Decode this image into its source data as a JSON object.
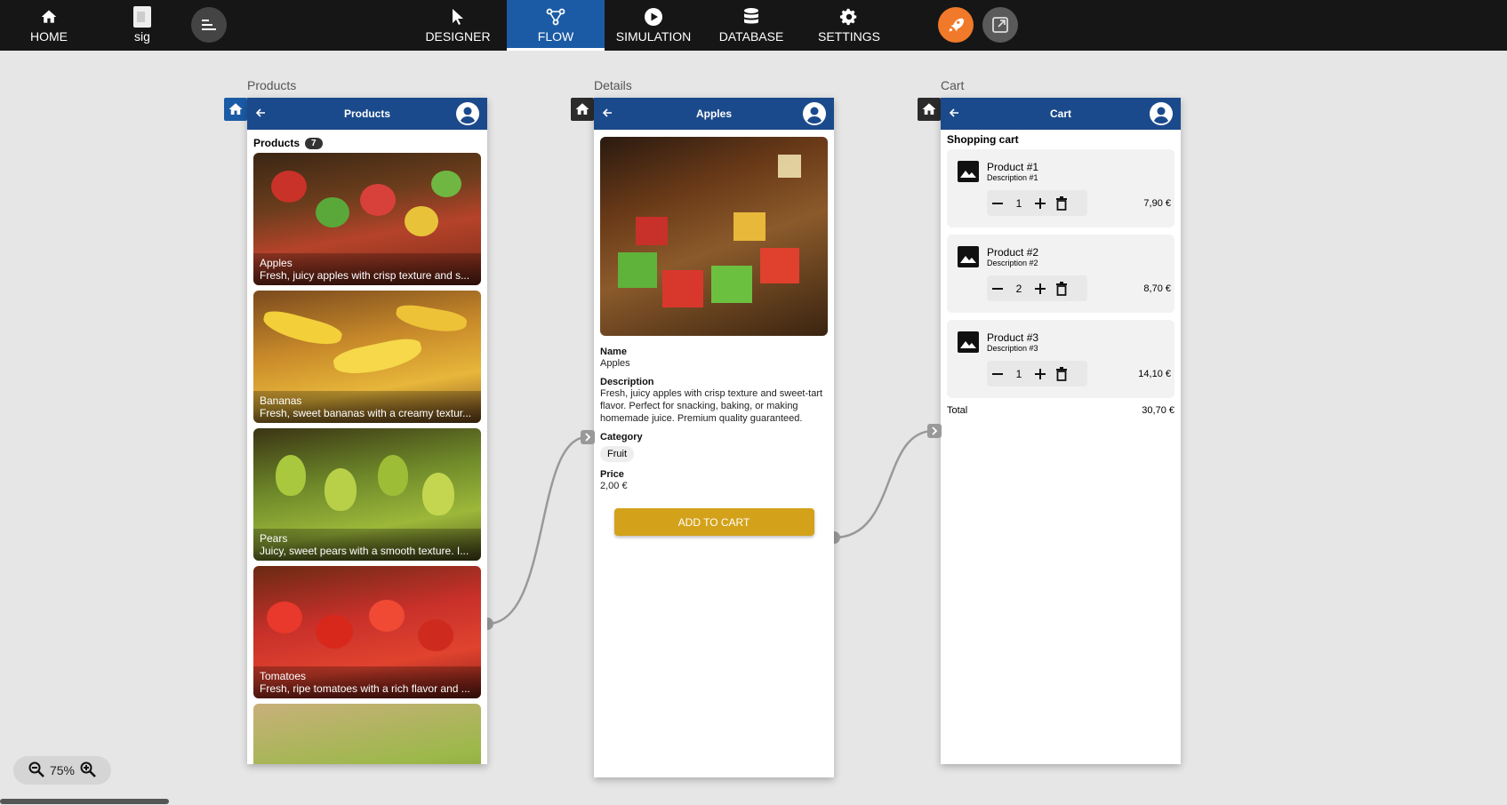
{
  "nav": {
    "home": "HOME",
    "file": "sig",
    "designer": "DESIGNER",
    "flow": "FLOW",
    "simulation": "SIMULATION",
    "database": "DATABASE",
    "settings": "SETTINGS"
  },
  "screens": {
    "products": {
      "label": "Products",
      "header": "Products",
      "list_title": "Products",
      "count": "7",
      "items": [
        {
          "name": "Apples",
          "desc": "Fresh, juicy apples with crisp texture and s..."
        },
        {
          "name": "Bananas",
          "desc": "Fresh, sweet bananas with a creamy textur..."
        },
        {
          "name": "Pears",
          "desc": "Juicy, sweet pears with a smooth texture. I..."
        },
        {
          "name": "Tomatoes",
          "desc": "Fresh, ripe tomatoes with a rich flavor and ..."
        }
      ]
    },
    "details": {
      "label": "Details",
      "header": "Apples",
      "name_label": "Name",
      "name": "Apples",
      "desc_label": "Description",
      "desc": "Fresh, juicy apples with crisp texture and sweet-tart flavor. Perfect for snacking, baking, or making homemade juice. Premium quality guaranteed.",
      "cat_label": "Category",
      "category": "Fruit",
      "price_label": "Price",
      "price": "2,00 €",
      "button": "ADD TO CART"
    },
    "cart": {
      "label": "Cart",
      "header": "Cart",
      "title": "Shopping cart",
      "items": [
        {
          "name": "Product #1",
          "desc": "Description #1",
          "qty": "1",
          "price": "7,90 €"
        },
        {
          "name": "Product #2",
          "desc": "Description #2",
          "qty": "2",
          "price": "8,70 €"
        },
        {
          "name": "Product #3",
          "desc": "Description #3",
          "qty": "1",
          "price": "14,10 €"
        }
      ],
      "total_label": "Total",
      "total": "30,70 €"
    }
  },
  "zoom": {
    "level": "75%"
  },
  "colors": {
    "accent": "#1b5ba5",
    "header": "#1b4a8c",
    "button": "#d3a21a",
    "rocket": "#f07a2a"
  }
}
